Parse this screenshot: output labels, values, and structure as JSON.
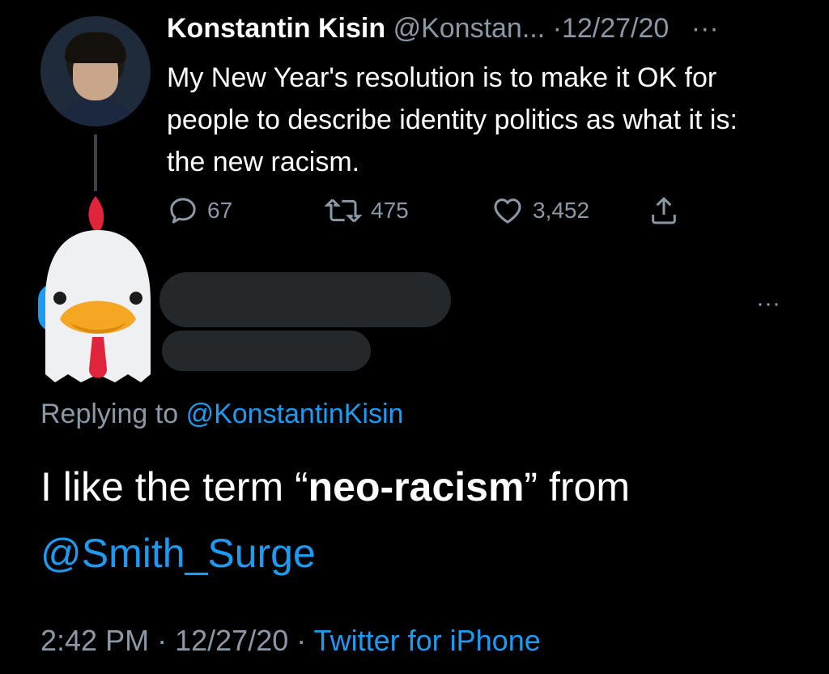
{
  "tweet": {
    "author_name": "Konstantin Kisin",
    "author_handle": "@Konstan...",
    "date_sep": "·",
    "date": "12/27/20",
    "more": "···",
    "text": "My New Year's resolution is to make it OK for people to describe identity politics as what it is: the new racism.",
    "replies": "67",
    "retweets": "475",
    "likes": "3,452"
  },
  "reply": {
    "more": "···",
    "replying_prefix": "Replying to",
    "replying_handle": "@KonstantinKisin",
    "text_before": "I like the term “",
    "text_bold": "neo-racism",
    "text_after": "” from",
    "mention": "@Smith_Surge",
    "time": "2:42 PM",
    "sep1": "·",
    "date": "12/27/20",
    "sep2": "·",
    "client": "Twitter for iPhone"
  },
  "colors": {
    "background": "#000000",
    "text": "#ffffff",
    "muted": "#8b98a5",
    "link": "#1d9bf0",
    "redaction": "#25282b"
  },
  "icons": [
    "reply-icon",
    "retweet-icon",
    "like-icon",
    "share-icon",
    "more-icon",
    "chicken-emoji"
  ]
}
